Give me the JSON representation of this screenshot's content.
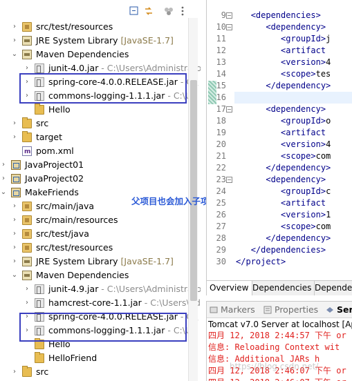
{
  "explorer": {
    "rows": [
      {
        "twisty": ">",
        "icon": "pkgfolder",
        "label": "src/test/resources",
        "suffix": ""
      },
      {
        "twisty": ">",
        "icon": "lib",
        "label": "JRE System Library",
        "suffix": "[JavaSE-1.7]"
      },
      {
        "twisty": "v",
        "icon": "lib",
        "label": "Maven Dependencies",
        "suffix": ""
      },
      {
        "twisty": ">",
        "icon": "jar",
        "label": "junit-4.0.jar",
        "suffix": "- C:\\Users\\Administrato"
      },
      {
        "twisty": ">",
        "icon": "jar",
        "label": "spring-core-4.0.0.RELEASE.jar",
        "suffix": "- C:\\"
      },
      {
        "twisty": ">",
        "icon": "jar",
        "label": "commons-logging-1.1.1.jar",
        "suffix": "- C:\\Us"
      },
      {
        "twisty": "",
        "icon": "folder",
        "label": "Hello",
        "suffix": ""
      },
      {
        "twisty": ">",
        "icon": "folder",
        "label": "src",
        "suffix": ""
      },
      {
        "twisty": ">",
        "icon": "folder",
        "label": "target",
        "suffix": ""
      },
      {
        "twisty": "",
        "icon": "pom",
        "label": "pom.xml",
        "suffix": ""
      },
      {
        "twisty": ">",
        "icon": "project",
        "label": "JavaProject01",
        "suffix": ""
      },
      {
        "twisty": ">",
        "icon": "project",
        "label": "JavaProject02",
        "suffix": ""
      },
      {
        "twisty": "v",
        "icon": "project",
        "label": "MakeFriends",
        "suffix": ""
      },
      {
        "twisty": ">",
        "icon": "pkgfolder",
        "label": "src/main/java",
        "suffix": ""
      },
      {
        "twisty": ">",
        "icon": "pkgfolder",
        "label": "src/main/resources",
        "suffix": ""
      },
      {
        "twisty": ">",
        "icon": "pkgfolder",
        "label": "src/test/java",
        "suffix": ""
      },
      {
        "twisty": ">",
        "icon": "pkgfolder",
        "label": "src/test/resources",
        "suffix": ""
      },
      {
        "twisty": ">",
        "icon": "lib",
        "label": "JRE System Library",
        "suffix": "[JavaSE-1.7]"
      },
      {
        "twisty": "v",
        "icon": "lib",
        "label": "Maven Dependencies",
        "suffix": ""
      },
      {
        "twisty": ">",
        "icon": "jar",
        "label": "junit-4.9.jar",
        "suffix": "- C:\\Users\\Administrato"
      },
      {
        "twisty": ">",
        "icon": "jar",
        "label": "hamcrest-core-1.1.jar",
        "suffix": "- C:\\Users\\Ad"
      },
      {
        "twisty": ">",
        "icon": "jar",
        "label": "spring-core-4.0.0.RELEASE.jar",
        "suffix": "- C:\\"
      },
      {
        "twisty": ">",
        "icon": "jar",
        "label": "commons-logging-1.1.1.jar",
        "suffix": "- C:\\Us"
      },
      {
        "twisty": "",
        "icon": "folder",
        "label": "Hello",
        "suffix": ""
      },
      {
        "twisty": "",
        "icon": "folder",
        "label": "HelloFriend",
        "suffix": ""
      },
      {
        "twisty": ">",
        "icon": "folder",
        "label": "src",
        "suffix": ""
      }
    ]
  },
  "editor": {
    "lines": [
      {
        "n": "9",
        "fold": "-",
        "indent": "   ",
        "parts": [
          [
            "tag",
            "<dependencies>"
          ]
        ]
      },
      {
        "n": "10",
        "fold": "-",
        "indent": "      ",
        "parts": [
          [
            "tag",
            "<dependency>"
          ]
        ]
      },
      {
        "n": "11",
        "fold": "",
        "indent": "         ",
        "parts": [
          [
            "tag",
            "<groupId>"
          ],
          [
            "txt",
            "j"
          ]
        ]
      },
      {
        "n": "12",
        "fold": "",
        "indent": "         ",
        "parts": [
          [
            "tag",
            "<artifact"
          ]
        ]
      },
      {
        "n": "13",
        "fold": "",
        "indent": "         ",
        "parts": [
          [
            "tag",
            "<version>"
          ],
          [
            "txt",
            "4"
          ]
        ]
      },
      {
        "n": "14",
        "fold": "",
        "indent": "         ",
        "parts": [
          [
            "tag",
            "<scope>"
          ],
          [
            "txt",
            "tes"
          ]
        ]
      },
      {
        "n": "15",
        "fold": "",
        "indent": "      ",
        "parts": [
          [
            "tag",
            "</dependency>"
          ]
        ]
      },
      {
        "n": "16",
        "fold": "",
        "indent": "",
        "parts": []
      },
      {
        "n": "17",
        "fold": "-",
        "indent": "      ",
        "parts": [
          [
            "tag",
            "<dependency>"
          ]
        ]
      },
      {
        "n": "18",
        "fold": "",
        "indent": "         ",
        "parts": [
          [
            "tag",
            "<groupId>"
          ],
          [
            "txt",
            "o"
          ]
        ]
      },
      {
        "n": "19",
        "fold": "",
        "indent": "         ",
        "parts": [
          [
            "tag",
            "<artifact"
          ]
        ]
      },
      {
        "n": "20",
        "fold": "",
        "indent": "         ",
        "parts": [
          [
            "tag",
            "<version>"
          ],
          [
            "txt",
            "4"
          ]
        ]
      },
      {
        "n": "21",
        "fold": "",
        "indent": "         ",
        "parts": [
          [
            "tag",
            "<scope>"
          ],
          [
            "txt",
            "com"
          ]
        ]
      },
      {
        "n": "22",
        "fold": "",
        "indent": "      ",
        "parts": [
          [
            "tag",
            "</dependency>"
          ]
        ]
      },
      {
        "n": "23",
        "fold": "-",
        "indent": "      ",
        "parts": [
          [
            "tag",
            "<dependency>"
          ]
        ]
      },
      {
        "n": "24",
        "fold": "",
        "indent": "         ",
        "parts": [
          [
            "tag",
            "<groupId>"
          ],
          [
            "txt",
            "c"
          ]
        ]
      },
      {
        "n": "25",
        "fold": "",
        "indent": "         ",
        "parts": [
          [
            "tag",
            "<artifact"
          ]
        ]
      },
      {
        "n": "26",
        "fold": "",
        "indent": "         ",
        "parts": [
          [
            "tag",
            "<version>"
          ],
          [
            "txt",
            "1"
          ]
        ]
      },
      {
        "n": "27",
        "fold": "",
        "indent": "         ",
        "parts": [
          [
            "tag",
            "<scope>"
          ],
          [
            "txt",
            "com"
          ]
        ]
      },
      {
        "n": "28",
        "fold": "",
        "indent": "      ",
        "parts": [
          [
            "tag",
            "</dependency>"
          ]
        ]
      },
      {
        "n": "29",
        "fold": "",
        "indent": "   ",
        "parts": [
          [
            "tag",
            "</dependencies>"
          ]
        ]
      },
      {
        "n": "30",
        "fold": "",
        "indent": "",
        "parts": [
          [
            "tag",
            "</project>"
          ]
        ]
      }
    ],
    "pom_tabs": [
      "Overview",
      "Dependencies",
      "Depender"
    ]
  },
  "bottom": {
    "tabs": [
      {
        "label": "Markers",
        "icon": "markers-icon"
      },
      {
        "label": "Properties",
        "icon": "properties-icon"
      },
      {
        "label": "Serv",
        "icon": "servers-icon"
      }
    ],
    "console_title": "Tomcat v7.0 Server at localhost [Apa",
    "console_lines": [
      "四月 12, 2018 2:44:57 下午 or",
      "信息: Reloading Context wit",
      "信息: Additional JARs h",
      "四月 12, 2018 2:46:07 下午 or",
      "四月 12, 2018 2:46:07 下午 or"
    ]
  },
  "annotation": "父项目也会加入子项目中有的依赖",
  "watermark": "https://blog.csdn.net/"
}
